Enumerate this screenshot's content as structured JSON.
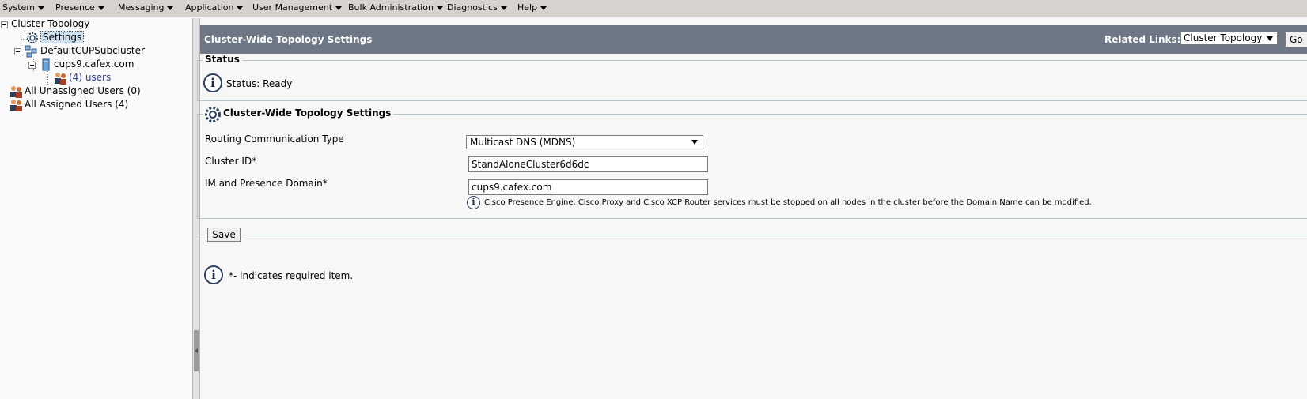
{
  "menu": [
    "System",
    "Presence",
    "Messaging",
    "Application",
    "User Management",
    "Bulk Administration",
    "Diagnostics",
    "Help"
  ],
  "tree": {
    "root": "Cluster Topology",
    "settings": "Settings",
    "subcluster": "DefaultCUPSubcluster",
    "node": "cups9.cafex.com",
    "users": "(4) users",
    "unassigned": "All Unassigned Users (0)",
    "assigned": "All Assigned Users (4)"
  },
  "header": {
    "title": "Cluster-Wide Topology Settings",
    "related_label": "Related Links:",
    "related_value": "Cluster Topology",
    "go_label": "Go"
  },
  "status": {
    "legend": "Status",
    "text": "Status: Ready"
  },
  "settings": {
    "legend": "Cluster-Wide Topology Settings",
    "routing_label": "Routing Communication Type",
    "routing_value": "Multicast DNS (MDNS)",
    "cluster_id_label": "Cluster ID",
    "cluster_id_value": "StandAloneCluster6d6dc",
    "domain_label": "IM and Presence Domain",
    "domain_value": "cups9.cafex.com",
    "required_mark": "*",
    "domain_note": "Cisco Presence Engine, Cisco Proxy and Cisco XCP Router services must be stopped on all nodes in the cluster before the Domain Name can be modified."
  },
  "save_label": "Save",
  "required_note": "*- indicates required item.",
  "icons": {
    "info": "info-icon",
    "gear": "gear-icon",
    "users": "users-icon",
    "server": "server-icon",
    "subcluster": "subcluster-icon"
  }
}
